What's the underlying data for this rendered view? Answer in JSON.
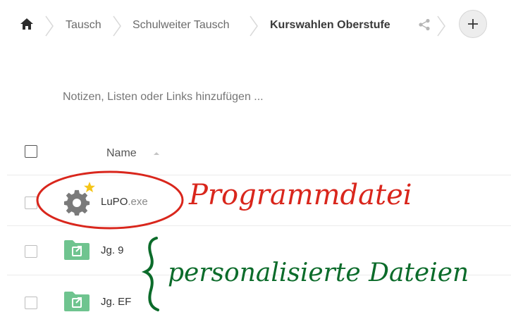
{
  "breadcrumb": {
    "items": [
      {
        "label": "Tausch"
      },
      {
        "label": "Schulweiter Tausch"
      },
      {
        "label": "Kurswahlen Oberstufe"
      }
    ],
    "home_icon": "home-icon",
    "share_icon": "share-icon",
    "add_icon": "plus-icon"
  },
  "notes": {
    "placeholder": "Notizen, Listen oder Links hinzufügen ..."
  },
  "file_list": {
    "header": {
      "name_label": "Name",
      "sort_icon": "sort-ascending-icon"
    },
    "rows": [
      {
        "name": "LuPO",
        "ext": ".exe",
        "icon": "gear-icon",
        "favorite_icon": "star-icon"
      },
      {
        "name": "Jg. 9",
        "ext": "",
        "icon": "shared-folder-icon"
      },
      {
        "name": "Jg. EF",
        "ext": "",
        "icon": "shared-folder-icon"
      }
    ]
  },
  "annotations": {
    "red_label": "Programmdatei",
    "green_label": "personalisierte Dateien",
    "red_color": "#d9261c",
    "green_color": "#0b6b2a"
  },
  "colors": {
    "folder": "#6fc48f",
    "star": "#f5c518",
    "gear": "#7a7a7a"
  }
}
